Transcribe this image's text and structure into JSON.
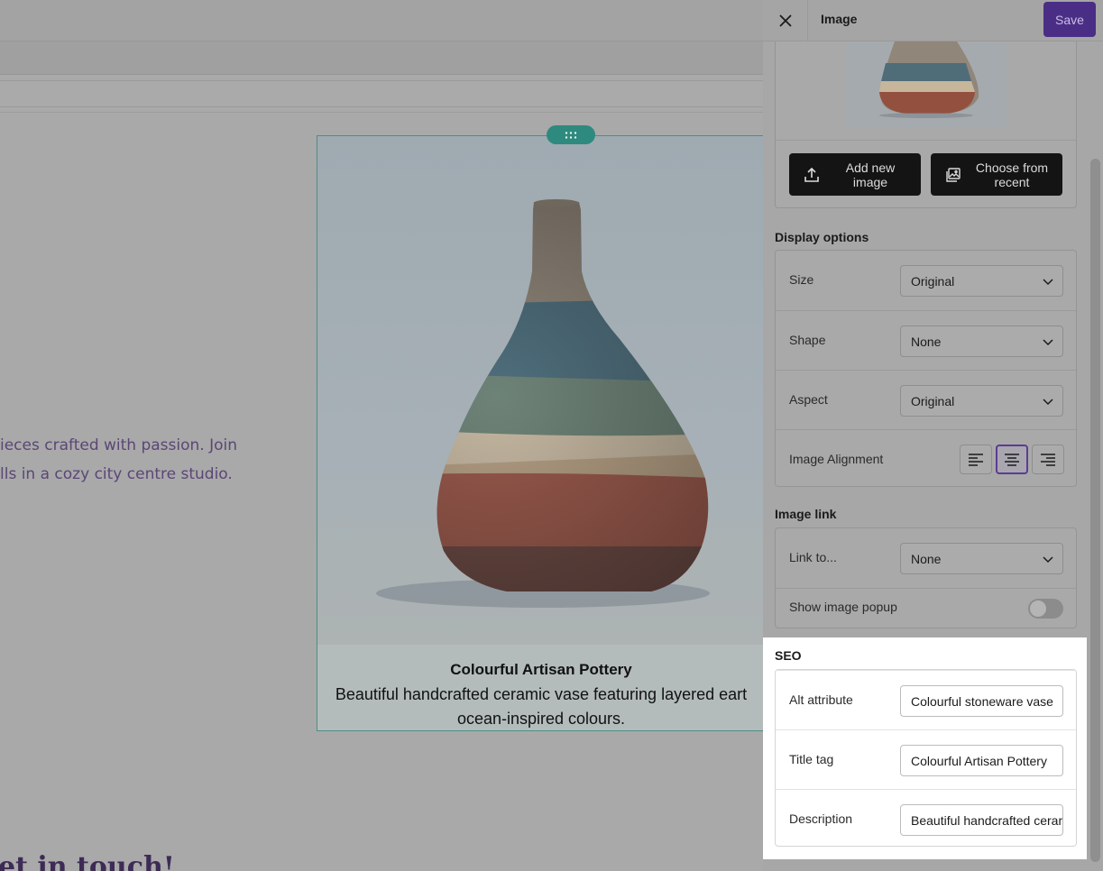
{
  "canvas": {
    "intro_lines": [
      "ieces crafted with passion. Join",
      "lls in a cozy city centre studio."
    ],
    "heading_partial": "et in touch!",
    "image_block": {
      "caption_title": "Colourful Artisan Pottery",
      "caption_text": "Beautiful handcrafted ceramic vase featuring layered eart ocean-inspired colours."
    }
  },
  "panel": {
    "title": "Image",
    "save_label": "Save",
    "image_buttons": {
      "add_new": "Add new image",
      "choose_recent": "Choose from recent"
    },
    "display_options": {
      "title": "Display options",
      "size_label": "Size",
      "size_value": "Original",
      "shape_label": "Shape",
      "shape_value": "None",
      "aspect_label": "Aspect",
      "aspect_value": "Original",
      "alignment_label": "Image Alignment",
      "alignment_selected": "center"
    },
    "image_link": {
      "title": "Image link",
      "link_label": "Link to...",
      "link_value": "None",
      "popup_label": "Show image popup",
      "popup_enabled": false
    },
    "seo": {
      "title": "SEO",
      "alt_label": "Alt attribute",
      "alt_value": "Colourful stoneware vase",
      "title_tag_label": "Title tag",
      "title_tag_value": "Colourful Artisan Pottery",
      "description_label": "Description",
      "description_value": "Beautiful handcrafted ceramic"
    }
  },
  "colors": {
    "accent": "#4a2e86",
    "handle": "#2e8a7e",
    "overlay": "#a8a8a8"
  }
}
